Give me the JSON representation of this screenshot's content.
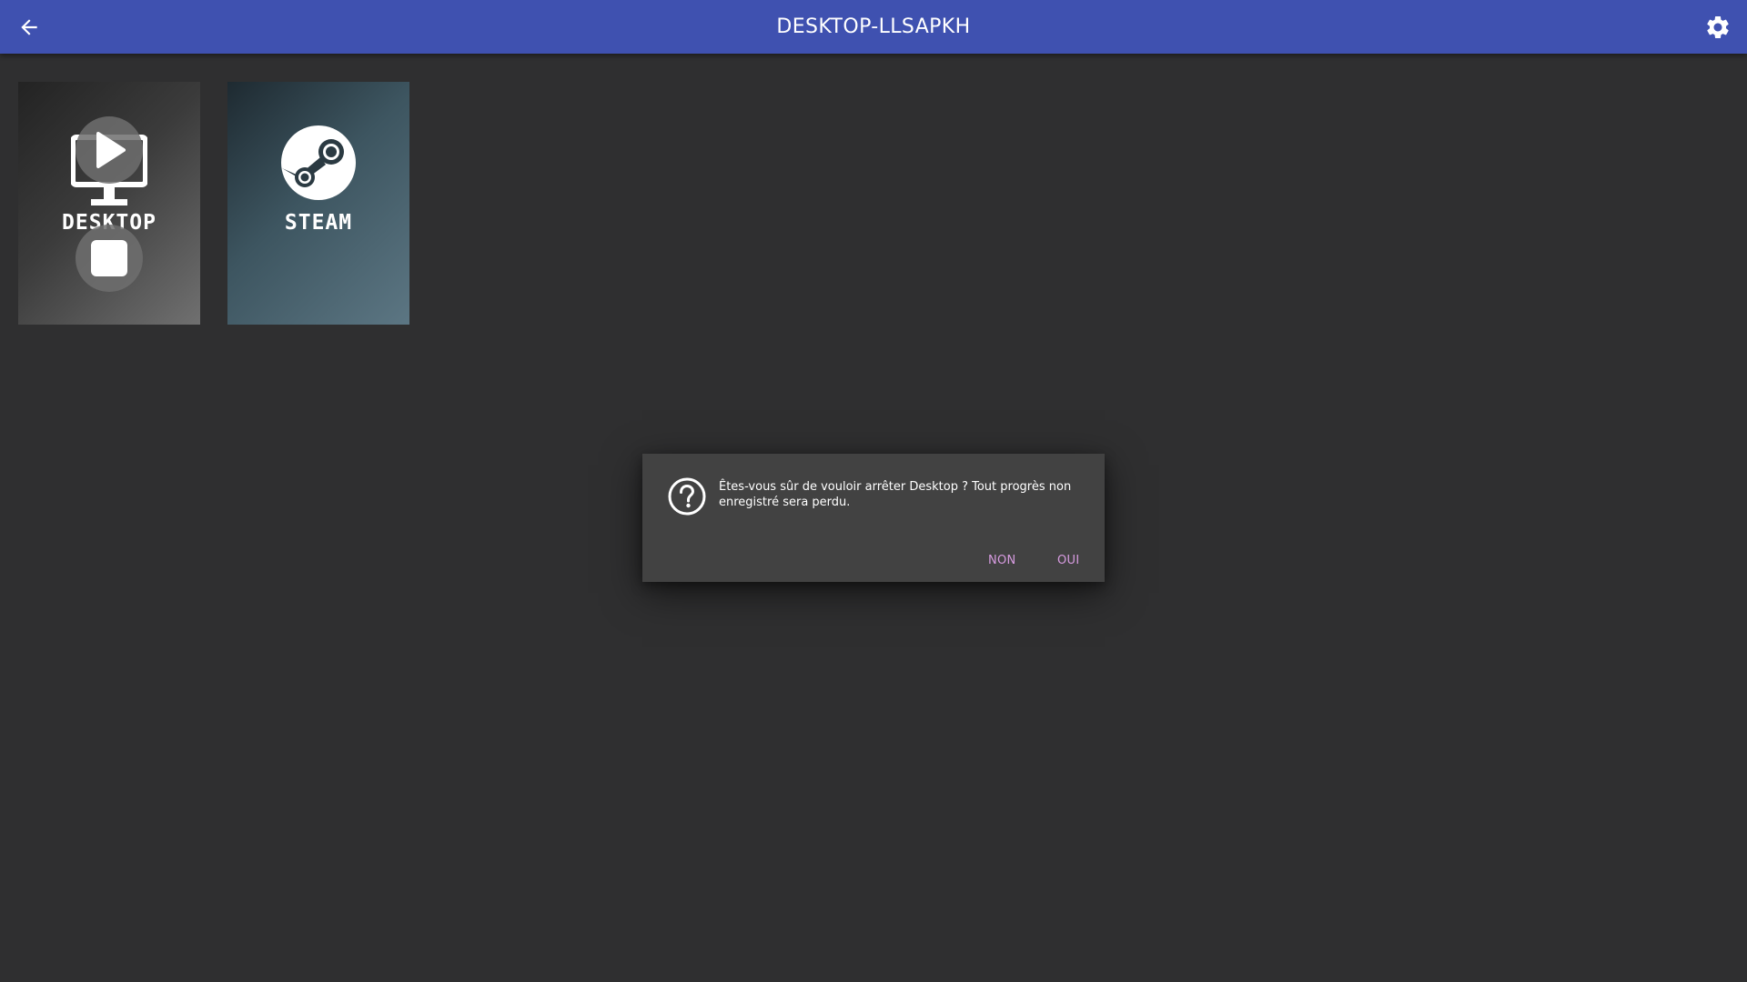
{
  "header": {
    "title": "DESKTOP-LLSAPKH",
    "back_icon": "arrow-left-icon",
    "settings_icon": "gear-icon",
    "background_color": "#3f51b0"
  },
  "apps": [
    {
      "name": "DESKTOP",
      "icon": "monitor-icon",
      "running": true
    },
    {
      "name": "STEAM",
      "icon": "steam-logo-icon",
      "running": false
    }
  ],
  "overlay": {
    "play_icon": "play-icon",
    "stop_icon": "stop-icon"
  },
  "dialog": {
    "icon": "question-circle-icon",
    "message": "Êtes-vous sûr de vouloir arrêter Desktop ? Tout progrès non enregistré sera perdu.",
    "no_label": "NON",
    "yes_label": "OUI",
    "accent_color": "#d79be0"
  }
}
